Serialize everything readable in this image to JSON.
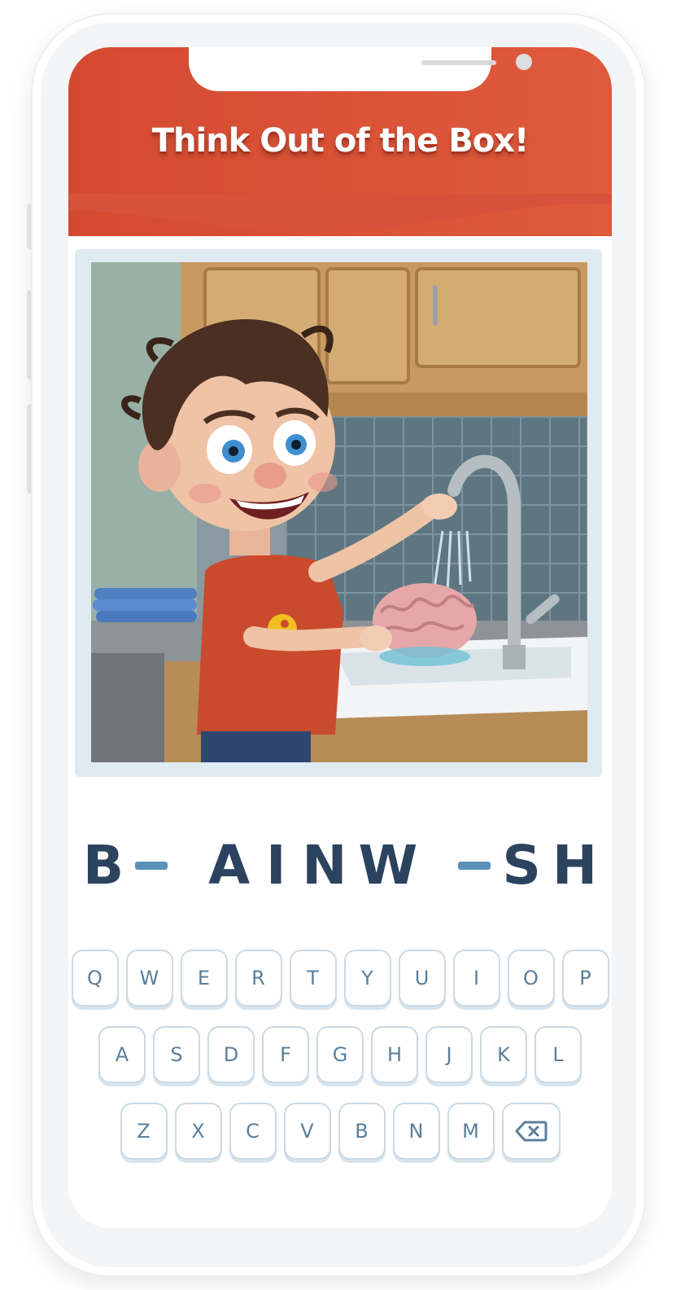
{
  "header": {
    "title": "Think Out of the Box!"
  },
  "puzzle": {
    "image_alt": "Cartoon boy washing a brain in a kitchen sink",
    "tiles": [
      {
        "letter": "B",
        "blank": false
      },
      {
        "letter": "",
        "blank": true
      },
      {
        "letter": "A",
        "blank": false
      },
      {
        "letter": "I",
        "blank": false
      },
      {
        "letter": "N",
        "blank": false
      },
      {
        "letter": "W",
        "blank": false
      },
      {
        "letter": "",
        "blank": true
      },
      {
        "letter": "S",
        "blank": false
      },
      {
        "letter": "H",
        "blank": false
      }
    ]
  },
  "keyboard": {
    "row1": [
      "Q",
      "W",
      "E",
      "R",
      "T",
      "Y",
      "U",
      "I",
      "O",
      "P"
    ],
    "row2": [
      "A",
      "S",
      "D",
      "F",
      "G",
      "H",
      "J",
      "K",
      "L"
    ],
    "row3": [
      "Z",
      "X",
      "C",
      "V",
      "B",
      "N",
      "M"
    ],
    "backspace_icon": "backspace-icon"
  },
  "colors": {
    "header": "#d44a31",
    "text_dark": "#2c4360",
    "blank": "#5d90b8",
    "key_text": "#5a7f9d"
  }
}
